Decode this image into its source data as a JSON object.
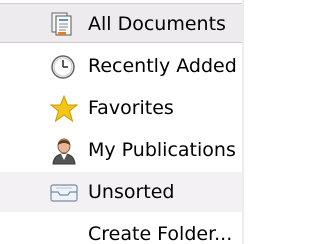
{
  "sidebar": {
    "items": [
      {
        "label": "All Documents",
        "icon": "documents-icon",
        "state": "selected"
      },
      {
        "label": "Recently Added",
        "icon": "clock-icon",
        "state": "normal"
      },
      {
        "label": "Favorites",
        "icon": "star-icon",
        "state": "normal"
      },
      {
        "label": "My Publications",
        "icon": "person-icon",
        "state": "normal"
      },
      {
        "label": "Unsorted",
        "icon": "tray-icon",
        "state": "highlighted"
      },
      {
        "label": "Create Folder...",
        "icon": "",
        "state": "normal"
      }
    ]
  },
  "colors": {
    "selected_bg": "#eeebee",
    "highlighted_bg": "#f4f1f4",
    "star": "#f5c518"
  }
}
